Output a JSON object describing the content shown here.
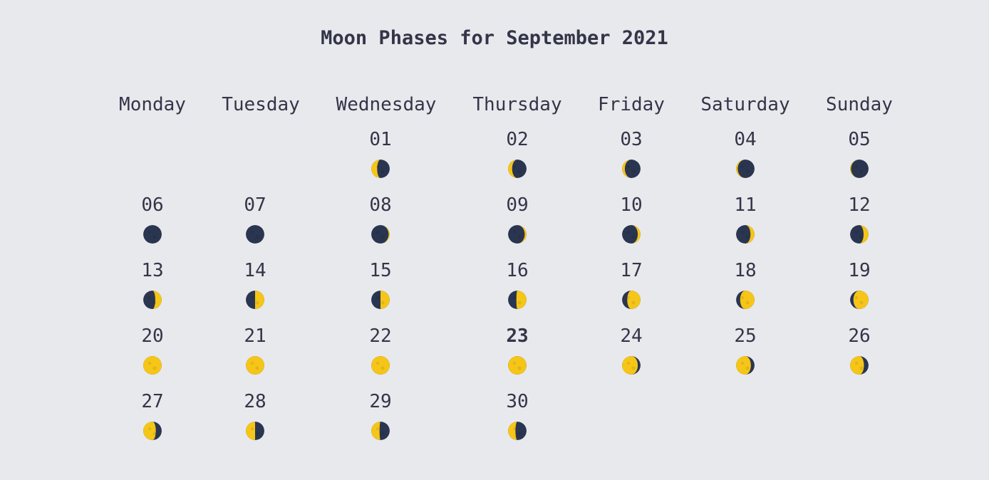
{
  "title": "Moon Phases for September 2021",
  "colors": {
    "dark": "#2a3550",
    "light": "#f5c518"
  },
  "weekdays": [
    "Monday",
    "Tuesday",
    "Wednesday",
    "Thursday",
    "Friday",
    "Saturday",
    "Sunday"
  ],
  "today": "23",
  "days": [
    {
      "label": "01",
      "lit": 0.32,
      "side": "left"
    },
    {
      "label": "02",
      "lit": 0.22,
      "side": "left"
    },
    {
      "label": "03",
      "lit": 0.15,
      "side": "left"
    },
    {
      "label": "04",
      "lit": 0.09,
      "side": "left"
    },
    {
      "label": "05",
      "lit": 0.05,
      "side": "left"
    },
    {
      "label": "06",
      "lit": 0.0,
      "side": "left"
    },
    {
      "label": "07",
      "lit": 0.0,
      "side": "left"
    },
    {
      "label": "08",
      "lit": 0.06,
      "side": "right"
    },
    {
      "label": "09",
      "lit": 0.1,
      "side": "right"
    },
    {
      "label": "10",
      "lit": 0.15,
      "side": "right"
    },
    {
      "label": "11",
      "lit": 0.22,
      "side": "right"
    },
    {
      "label": "12",
      "lit": 0.27,
      "side": "right"
    },
    {
      "label": "13",
      "lit": 0.35,
      "side": "right"
    },
    {
      "label": "14",
      "lit": 0.5,
      "side": "right"
    },
    {
      "label": "15",
      "lit": 0.5,
      "side": "right"
    },
    {
      "label": "16",
      "lit": 0.55,
      "side": "right"
    },
    {
      "label": "17",
      "lit": 0.72,
      "side": "right"
    },
    {
      "label": "18",
      "lit": 0.78,
      "side": "right"
    },
    {
      "label": "19",
      "lit": 0.82,
      "side": "right"
    },
    {
      "label": "20",
      "lit": 1.0,
      "side": "right"
    },
    {
      "label": "21",
      "lit": 1.0,
      "side": "right"
    },
    {
      "label": "22",
      "lit": 1.0,
      "side": "right"
    },
    {
      "label": "23",
      "lit": 1.0,
      "side": "right"
    },
    {
      "label": "24",
      "lit": 0.85,
      "side": "left"
    },
    {
      "label": "25",
      "lit": 0.8,
      "side": "left"
    },
    {
      "label": "26",
      "lit": 0.75,
      "side": "left"
    },
    {
      "label": "27",
      "lit": 0.68,
      "side": "left"
    },
    {
      "label": "28",
      "lit": 0.5,
      "side": "left"
    },
    {
      "label": "29",
      "lit": 0.45,
      "side": "left"
    },
    {
      "label": "30",
      "lit": 0.4,
      "side": "left"
    }
  ]
}
